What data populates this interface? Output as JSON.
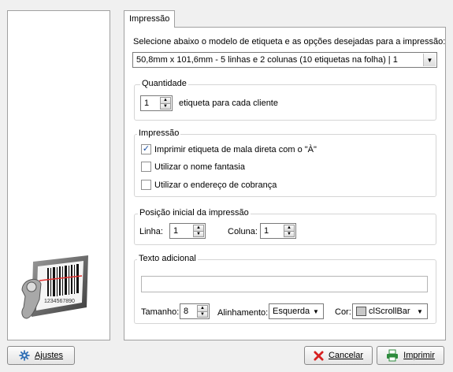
{
  "tab": {
    "label": "Impressão"
  },
  "instructions": "Selecione abaixo o modelo de etiqueta e as opções desejadas para a impressão:",
  "model_select": {
    "value": "50,8mm x 101,6mm - 5 linhas e 2 colunas (10 etiquetas na folha) | 1"
  },
  "quantidade": {
    "legend": "Quantidade",
    "value": "1",
    "label": "etiqueta para cada cliente"
  },
  "impressao": {
    "legend": "Impressão",
    "options": [
      {
        "label": "Imprimir etiqueta de mala direta com o \"À\"",
        "checked": true
      },
      {
        "label": "Utilizar o nome fantasia",
        "checked": false
      },
      {
        "label": "Utilizar o endereço de cobrança",
        "checked": false
      }
    ]
  },
  "posicao": {
    "legend": "Posição inicial da impressão",
    "linha_label": "Linha:",
    "linha_value": "1",
    "coluna_label": "Coluna:",
    "coluna_value": "1"
  },
  "texto_adicional": {
    "legend": "Texto adicional",
    "value": "",
    "tamanho_label": "Tamanho:",
    "tamanho_value": "8",
    "alinhamento_label": "Alinhamento:",
    "alinhamento_value": "Esquerda",
    "cor_label": "Cor:",
    "cor_value": "clScrollBar",
    "cor_swatch": "#c8c8c8"
  },
  "buttons": {
    "ajustes": "Ajustes",
    "cancelar": "Cancelar",
    "imprimir": "Imprimir"
  },
  "logo": {
    "barcode_digits": "1234567890"
  },
  "icons": {
    "ajustes": "gear-icon",
    "cancelar": "close-icon",
    "imprimir": "printer-icon"
  },
  "colors": {
    "cancel_icon": "#d62020",
    "print_icon": "#2e8b3d",
    "gear_icon": "#2f6fb5"
  }
}
